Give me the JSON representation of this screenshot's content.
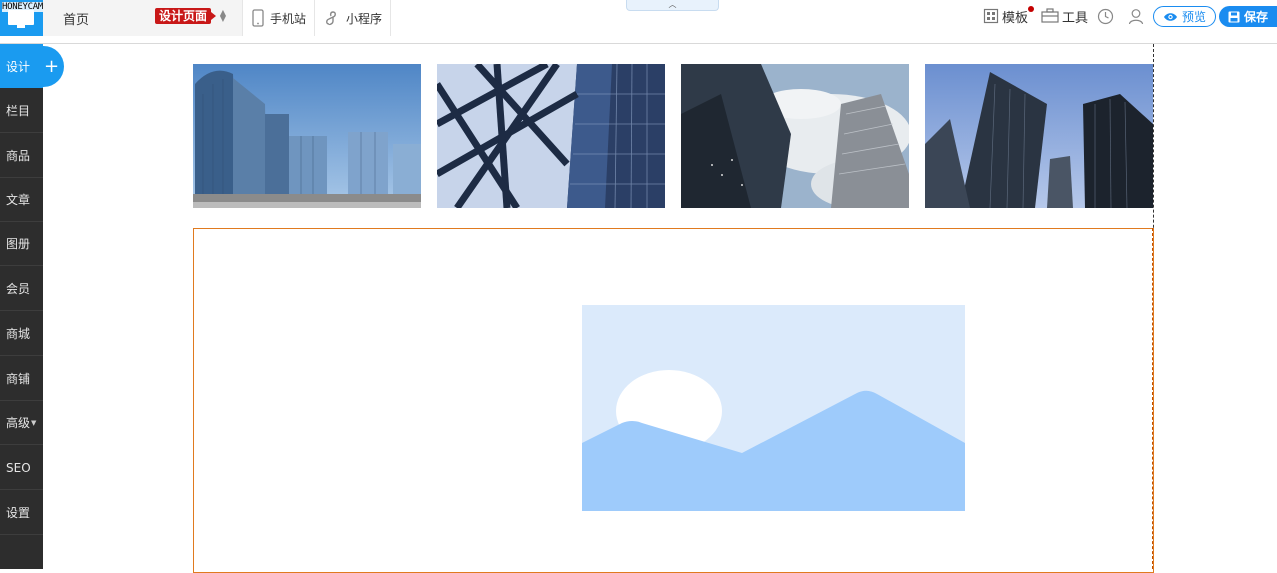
{
  "watermark": "HONEYCAM",
  "topbar": {
    "page_name": "首页",
    "page_badge": "设计页面",
    "mobile_site_label": "手机站",
    "mini_program_label": "小程序",
    "template_label": "模板",
    "tools_label": "工具",
    "preview_label": "预览",
    "save_label": "保存",
    "collapse_icon": "chevron-up-icon",
    "notify_color": "#c40000"
  },
  "sidebar": {
    "items": [
      {
        "label": "设计",
        "active": true
      },
      {
        "label": "栏目"
      },
      {
        "label": "商品"
      },
      {
        "label": "文章"
      },
      {
        "label": "图册"
      },
      {
        "label": "会员"
      },
      {
        "label": "商城"
      },
      {
        "label": "商铺"
      },
      {
        "label": "高级",
        "has_dropdown": true
      },
      {
        "label": "SEO"
      },
      {
        "label": "设置"
      }
    ],
    "add_label": "+"
  },
  "colors": {
    "accent": "#1a9bf0",
    "sidebar_bg": "#2d2d2d",
    "badge": "#c81818",
    "module_border": "#e07a1f",
    "placeholder_bg": "#dbeafb",
    "placeholder_mountain": "#9ecbfb"
  },
  "gallery": {
    "images": [
      "city-skyline-photo",
      "building-lattice-photo",
      "skyscrapers-sky-photo",
      "office-towers-photo"
    ]
  }
}
